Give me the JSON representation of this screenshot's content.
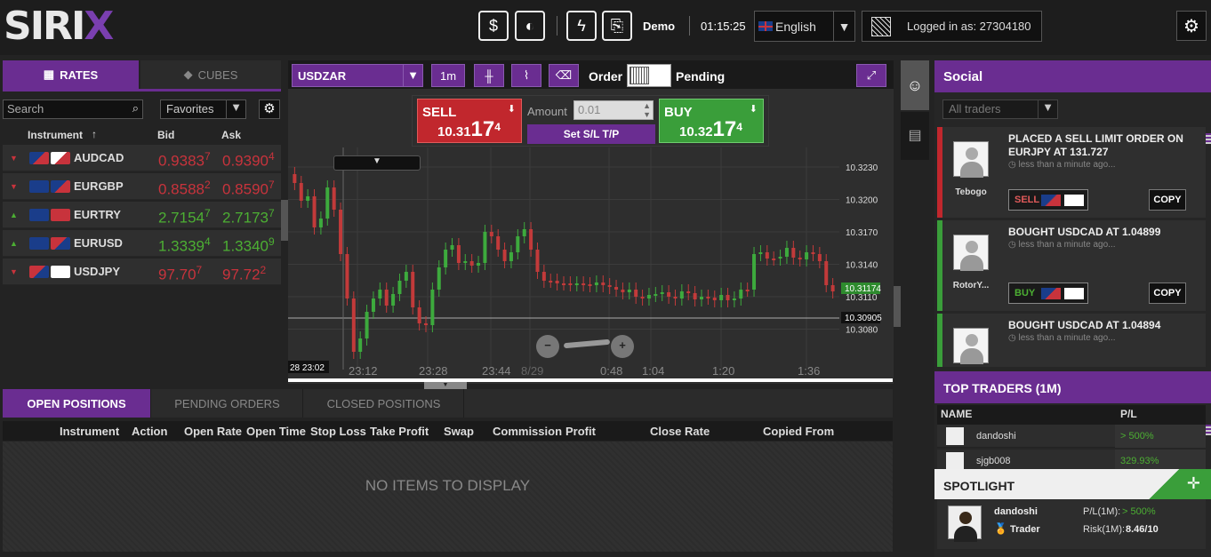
{
  "header": {
    "logo": "SIRI",
    "logo_x": "X",
    "account_type": "Demo",
    "clock": "01:15:25",
    "language": "English",
    "logged_in_label": "Logged in as: 27304180"
  },
  "rates_panel": {
    "tab_rates": "RATES",
    "tab_cubes": "CUBES",
    "search_placeholder": "Search",
    "favorites": "Favorites",
    "col_instrument": "Instrument",
    "col_bid": "Bid",
    "col_ask": "Ask",
    "rows": [
      {
        "instrument": "AUDCAD",
        "bid_main": "0.9383",
        "bid_pip": "7",
        "ask_main": "0.9390",
        "ask_pip": "4",
        "direction": "down"
      },
      {
        "instrument": "EURGBP",
        "bid_main": "0.8588",
        "bid_pip": "2",
        "ask_main": "0.8590",
        "ask_pip": "7",
        "direction": "down"
      },
      {
        "instrument": "EURTRY",
        "bid_main": "2.7154",
        "bid_pip": "7",
        "ask_main": "2.7173",
        "ask_pip": "7",
        "direction": "up"
      },
      {
        "instrument": "EURUSD",
        "bid_main": "1.3339",
        "bid_pip": "4",
        "ask_main": "1.3340",
        "ask_pip": "9",
        "direction": "up"
      },
      {
        "instrument": "USDJPY",
        "bid_main": "97.70",
        "bid_pip": "7",
        "ask_main": "97.72",
        "ask_pip": "2",
        "direction": "down"
      }
    ]
  },
  "chart_toolbar": {
    "symbol": "USDZAR",
    "timeframe": "1m",
    "order_label": "Order",
    "pending_label": "Pending"
  },
  "trade": {
    "sell_label": "SELL",
    "sell_prefix": "10.31",
    "sell_big": "17",
    "sell_pip": "4",
    "buy_label": "BUY",
    "buy_prefix": "10.32",
    "buy_big": "17",
    "buy_pip": "4",
    "amount_label": "Amount",
    "amount_value": "0.01",
    "set_sltp": "Set S/L T/P"
  },
  "chart": {
    "price_labels": [
      "10.3230",
      "10.3200",
      "10.3170",
      "10.3140",
      "10.3110",
      "10.3080"
    ],
    "current_price": "10.31174",
    "crosshair_price": "10.30905",
    "crosshair_time": "28 23:02",
    "time_labels": [
      "23:12",
      "23:28",
      "23:44",
      "8/29",
      "0:48",
      "1:04",
      "1:20",
      "1:36"
    ]
  },
  "positions": {
    "tab_open": "OPEN POSITIONS",
    "tab_pending": "PENDING ORDERS",
    "tab_closed": "CLOSED POSITIONS",
    "columns": [
      "Instrument",
      "Action",
      "Open Rate",
      "Open Time",
      "Stop Loss",
      "Take Profit",
      "Swap",
      "Commission",
      "Profit",
      "Close Rate",
      "Copied From"
    ],
    "empty_text": "NO ITEMS TO DISPLAY"
  },
  "social": {
    "title": "Social",
    "filter_placeholder": "All traders",
    "feed": [
      {
        "name": "Tebogo",
        "title": "PLACED A SELL LIMIT ORDER ON EURJPY AT 131.727",
        "time": "less than a minute ago...",
        "action": "SELL",
        "copy": "COPY",
        "color": "#c1272d"
      },
      {
        "name": "RotorY...",
        "title": "BOUGHT USDCAD AT 1.04899",
        "time": "less than a minute ago...",
        "action": "BUY",
        "copy": "COPY",
        "color": "#3a9e3a"
      },
      {
        "name": "",
        "title": "BOUGHT USDCAD AT 1.04894",
        "time": "less than a minute ago...",
        "action": "",
        "copy": "",
        "color": "#3a9e3a"
      }
    ]
  },
  "top_traders": {
    "title": "TOP TRADERS (1M)",
    "col_name": "NAME",
    "col_pl": "P/L",
    "rows": [
      {
        "name": "dandoshi",
        "pl": "> 500%"
      },
      {
        "name": "sjgb008",
        "pl": "329.93%"
      }
    ]
  },
  "spotlight": {
    "title": "SPOTLIGHT",
    "name": "dandoshi",
    "rank": "Trader",
    "pl_label": "P/L(1M):",
    "pl_value": "> 500%",
    "risk_label": "Risk(1M):",
    "risk_value": "8.46/10"
  }
}
